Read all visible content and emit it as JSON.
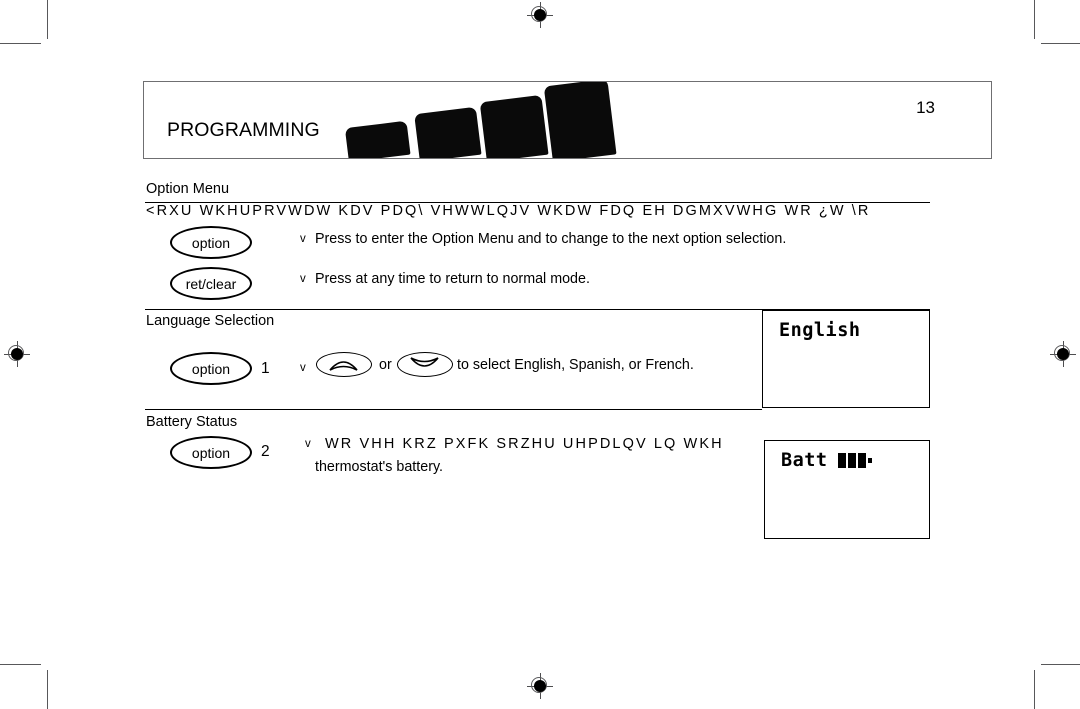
{
  "page": {
    "number": "13",
    "banner_title": "PROGRAMMING",
    "decor_bars": 4
  },
  "sections": [
    {
      "id": "option-menu",
      "heading": "Option Menu",
      "intro_encoded": "<RXU WKHUPRVWDW KDV PDQ\\ VHWWLQJV WKDW FDQ EH DGMXVWHG WR ¿W \\R",
      "rows": [
        {
          "button_label": "option",
          "bullet": "v",
          "text": "Press to enter the Option Menu and to change to the next option selection."
        },
        {
          "button_label": "ret/clear",
          "bullet": "v",
          "text": "Press at any time to return to normal mode."
        }
      ]
    },
    {
      "id": "language-selection",
      "heading": "Language Selection",
      "rows": [
        {
          "button_label": "option",
          "step": "1",
          "bullet": "v",
          "text_before": "",
          "conjunction": "or",
          "text_after": "to select English, Spanish, or French.",
          "arrow_up_icon": "arrow-up-icon",
          "arrow_down_icon": "arrow-down-icon"
        }
      ],
      "lcd": {
        "text": "English"
      }
    },
    {
      "id": "battery-status",
      "heading": "Battery Status",
      "rows": [
        {
          "button_label": "option",
          "step": "2",
          "bullet": "v",
          "text_encoded": "WR VHH KRZ PXFK SRZHU UHPDLQV LQ WKH",
          "text_line2": "thermostat's battery."
        }
      ],
      "lcd": {
        "label": "Batt",
        "battery_segments": 3,
        "battery_icon": "battery-icon"
      }
    }
  ],
  "print_marks": {
    "registration_icon": "registration-target-icon",
    "crop_mark_icon": "crop-mark-icon"
  },
  "colors": {
    "ink": "#000000",
    "mark_gray": "#58585a",
    "banner_border": "#6f6f71"
  }
}
